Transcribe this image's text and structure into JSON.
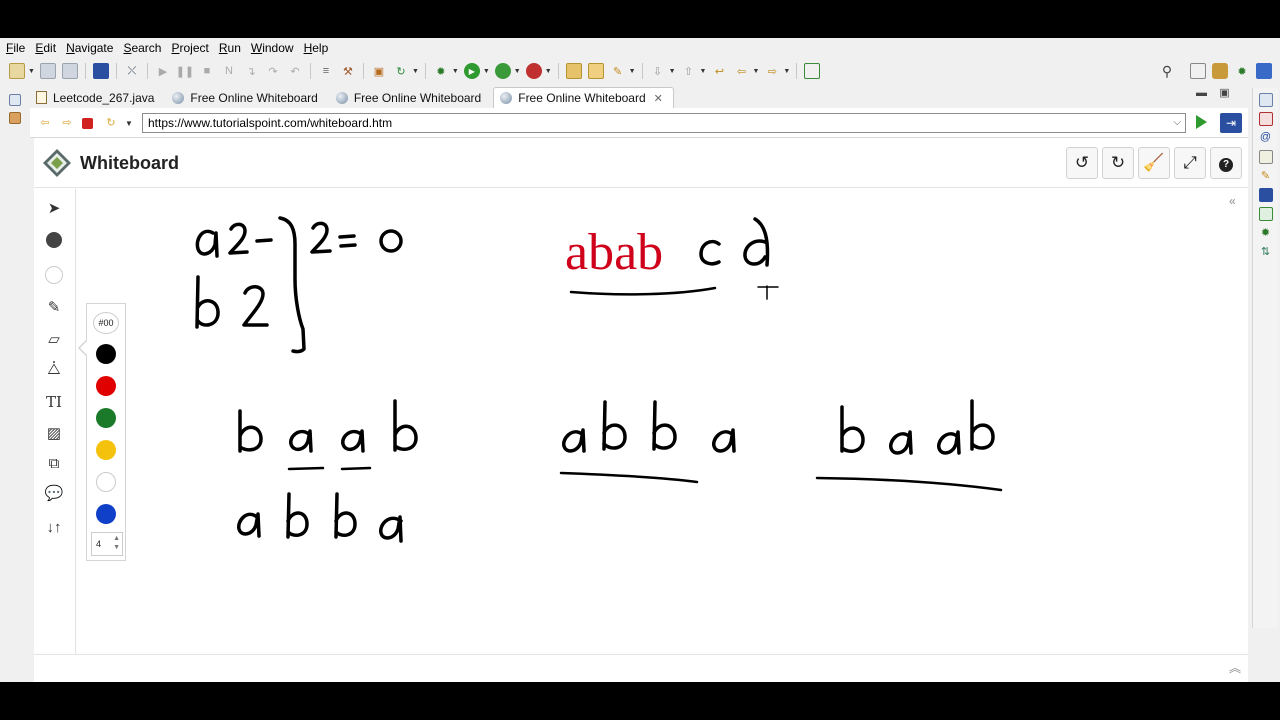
{
  "menu": [
    "File",
    "Edit",
    "Navigate",
    "Search",
    "Project",
    "Run",
    "Window",
    "Help"
  ],
  "tabs": [
    {
      "label": "Leetcode_267.java",
      "icon": "java-file-icon",
      "active": false
    },
    {
      "label": "Free Online Whiteboard",
      "icon": "globe-icon",
      "active": false
    },
    {
      "label": "Free Online Whiteboard",
      "icon": "globe-icon",
      "active": false
    },
    {
      "label": "Free Online Whiteboard",
      "icon": "globe-icon",
      "active": true
    }
  ],
  "browser": {
    "url": "https://www.tutorialspoint.com/whiteboard.htm"
  },
  "whiteboard": {
    "title": "Whiteboard",
    "palette": {
      "hex_label": "#00",
      "colors": [
        "#000000",
        "#e00000",
        "#1a7a2a",
        "#f4c20d",
        "#ffffff",
        "#1040c8"
      ],
      "size": "4"
    },
    "canvas_text": {
      "red_word": "abab"
    }
  },
  "colors": {
    "ink": "#000000",
    "red_ink": "#d0021b",
    "accent": "#2a4fa0"
  }
}
